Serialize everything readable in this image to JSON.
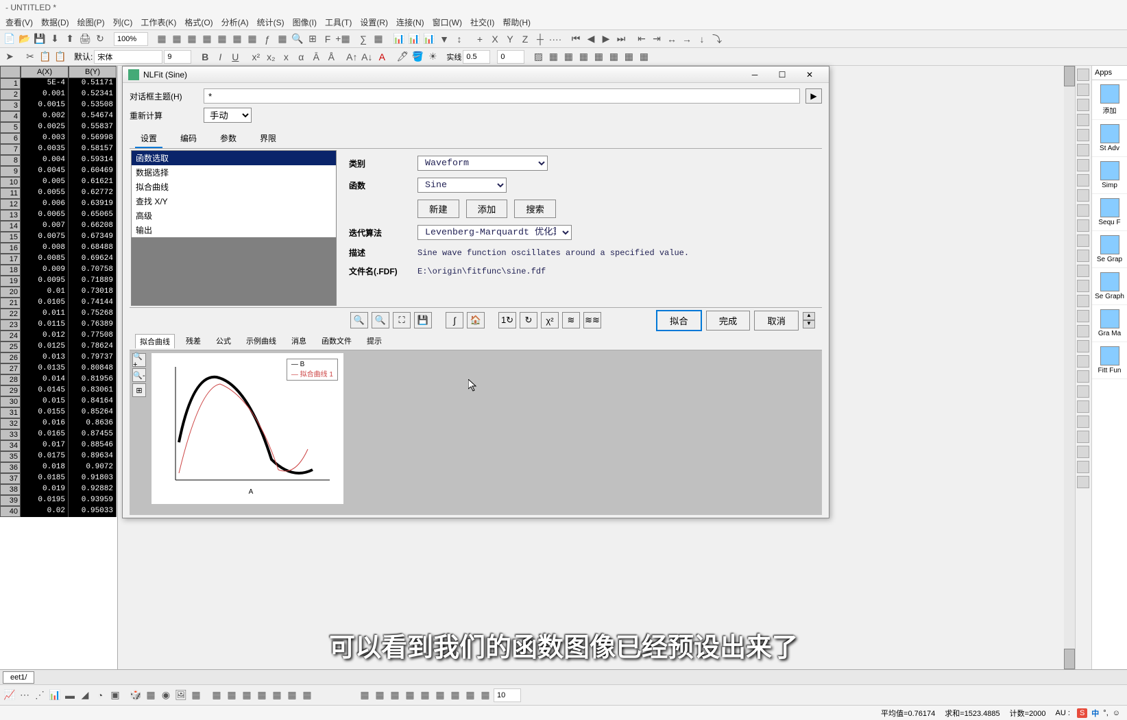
{
  "window_title": "- UNTITLED *",
  "menu": {
    "view": "查看(V)",
    "data": "数据(D)",
    "plot": "绘图(P)",
    "column": "列(C)",
    "worksheet": "工作表(K)",
    "format": "格式(O)",
    "analysis": "分析(A)",
    "statistics": "统计(S)",
    "image": "图像(I)",
    "tools": "工具(T)",
    "setup": "设置(R)",
    "connect": "连接(N)",
    "window": "窗口(W)",
    "social": "社交(I)",
    "help": "帮助(H)"
  },
  "toolbar1": {
    "zoom": "100%",
    "font_prefix": "默认:",
    "font_name": "宋体",
    "font_size": "9",
    "line_style": "实线",
    "line_width": "0.5",
    "num1": "0"
  },
  "worksheet": {
    "colA": "A(X)",
    "colB": "B(Y)",
    "rows": [
      {
        "n": 1,
        "a": "5E-4",
        "b": "0.51171"
      },
      {
        "n": 2,
        "a": "0.001",
        "b": "0.52341"
      },
      {
        "n": 3,
        "a": "0.0015",
        "b": "0.53508"
      },
      {
        "n": 4,
        "a": "0.002",
        "b": "0.54674"
      },
      {
        "n": 5,
        "a": "0.0025",
        "b": "0.55837"
      },
      {
        "n": 6,
        "a": "0.003",
        "b": "0.56998"
      },
      {
        "n": 7,
        "a": "0.0035",
        "b": "0.58157"
      },
      {
        "n": 8,
        "a": "0.004",
        "b": "0.59314"
      },
      {
        "n": 9,
        "a": "0.0045",
        "b": "0.60469"
      },
      {
        "n": 10,
        "a": "0.005",
        "b": "0.61621"
      },
      {
        "n": 11,
        "a": "0.0055",
        "b": "0.62772"
      },
      {
        "n": 12,
        "a": "0.006",
        "b": "0.63919"
      },
      {
        "n": 13,
        "a": "0.0065",
        "b": "0.65065"
      },
      {
        "n": 14,
        "a": "0.007",
        "b": "0.66208"
      },
      {
        "n": 15,
        "a": "0.0075",
        "b": "0.67349"
      },
      {
        "n": 16,
        "a": "0.008",
        "b": "0.68488"
      },
      {
        "n": 17,
        "a": "0.0085",
        "b": "0.69624"
      },
      {
        "n": 18,
        "a": "0.009",
        "b": "0.70758"
      },
      {
        "n": 19,
        "a": "0.0095",
        "b": "0.71889"
      },
      {
        "n": 20,
        "a": "0.01",
        "b": "0.73018"
      },
      {
        "n": 21,
        "a": "0.0105",
        "b": "0.74144"
      },
      {
        "n": 22,
        "a": "0.011",
        "b": "0.75268"
      },
      {
        "n": 23,
        "a": "0.0115",
        "b": "0.76389"
      },
      {
        "n": 24,
        "a": "0.012",
        "b": "0.77508"
      },
      {
        "n": 25,
        "a": "0.0125",
        "b": "0.78624"
      },
      {
        "n": 26,
        "a": "0.013",
        "b": "0.79737"
      },
      {
        "n": 27,
        "a": "0.0135",
        "b": "0.80848"
      },
      {
        "n": 28,
        "a": "0.014",
        "b": "0.81956"
      },
      {
        "n": 29,
        "a": "0.0145",
        "b": "0.83061"
      },
      {
        "n": 30,
        "a": "0.015",
        "b": "0.84164"
      },
      {
        "n": 31,
        "a": "0.0155",
        "b": "0.85264"
      },
      {
        "n": 32,
        "a": "0.016",
        "b": "0.8636"
      },
      {
        "n": 33,
        "a": "0.0165",
        "b": "0.87455"
      },
      {
        "n": 34,
        "a": "0.017",
        "b": "0.88546"
      },
      {
        "n": 35,
        "a": "0.0175",
        "b": "0.89634"
      },
      {
        "n": 36,
        "a": "0.018",
        "b": "0.9072"
      },
      {
        "n": 37,
        "a": "0.0185",
        "b": "0.91803"
      },
      {
        "n": 38,
        "a": "0.019",
        "b": "0.92882"
      },
      {
        "n": 39,
        "a": "0.0195",
        "b": "0.93959"
      },
      {
        "n": 40,
        "a": "0.02",
        "b": "0.95033"
      }
    ]
  },
  "dialog": {
    "title": "NLFit (Sine)",
    "theme_label": "对话框主题(H)",
    "theme_value": "*",
    "recalc_label": "重新计算",
    "recalc_value": "手动",
    "tabs": {
      "settings": "设置",
      "code": "编码",
      "params": "参数",
      "bounds": "界限"
    },
    "list": {
      "function_select": "函数选取",
      "data_select": "数据选择",
      "fit_curve": "拟合曲线",
      "find_xy": "查找 X/Y",
      "advanced": "高级",
      "output": "输出"
    },
    "form": {
      "category_label": "类别",
      "category_value": "Waveform",
      "function_label": "函数",
      "function_value": "Sine",
      "btn_new": "新建",
      "btn_add": "添加",
      "btn_search": "搜索",
      "algo_label": "迭代算法",
      "algo_value": "Levenberg-Marquardt 优化算法",
      "desc_label": "描述",
      "desc_value": "Sine wave function oscillates around a specified value.",
      "file_label": "文件名(.FDF)",
      "file_value": "E:\\origin\\fitfunc\\sine.fdf"
    },
    "actions": {
      "fit": "拟合",
      "done": "完成",
      "cancel": "取消"
    },
    "preview_tabs": {
      "fit_curve": "拟合曲线",
      "residual": "残差",
      "formula": "公式",
      "sample": "示例曲线",
      "message": "消息",
      "func_file": "函数文件",
      "hint": "提示"
    },
    "legend": {
      "s1": "B",
      "s2": "拟合曲线 1"
    }
  },
  "sheet_tab": "eet1/",
  "bottom_num": "10",
  "status": {
    "mean": "平均值=0.76174",
    "sum": "求和=1523.4885",
    "count": "计数=2000",
    "au": "AU :",
    "ime": "S",
    "lang": "中"
  },
  "apps": {
    "title": "Apps",
    "items": [
      {
        "label": "添加"
      },
      {
        "label": "St Adv"
      },
      {
        "label": "Simp"
      },
      {
        "label": "Sequ F"
      },
      {
        "label": "Se Grap"
      },
      {
        "label": "Se Graph"
      },
      {
        "label": "Gra Ma"
      },
      {
        "label": "Fitt Fun"
      }
    ]
  },
  "subtitle": "可以看到我们的函数图像已经预设出来了",
  "chart_data": {
    "type": "line",
    "title": "",
    "xlabel": "A",
    "ylabel": "",
    "xlim": [
      0,
      1.0
    ],
    "ylim": [
      -1.0,
      2.5
    ],
    "series": [
      {
        "name": "B",
        "x": [
          0.0,
          0.05,
          0.1,
          0.15,
          0.2,
          0.25,
          0.3,
          0.35,
          0.4,
          0.45,
          0.5,
          0.55,
          0.6,
          0.65,
          0.7,
          0.75,
          0.8,
          0.85,
          0.9,
          0.95,
          1.0
        ],
        "y": [
          0.5,
          1.35,
          2.0,
          2.35,
          2.4,
          2.2,
          1.75,
          1.2,
          0.6,
          0.1,
          -0.3,
          -0.55,
          -0.6,
          -0.48,
          -0.25,
          0.0,
          0.15,
          0.2,
          0.15,
          0.05,
          -0.05
        ]
      },
      {
        "name": "拟合曲线 1",
        "x": [
          0.0,
          0.1,
          0.2,
          0.3,
          0.4,
          0.5,
          0.6,
          0.7,
          0.8,
          0.85
        ],
        "y": [
          -0.7,
          1.2,
          2.2,
          2.2,
          1.3,
          0.1,
          -0.55,
          -0.35,
          0.3,
          0.6
        ]
      }
    ]
  }
}
